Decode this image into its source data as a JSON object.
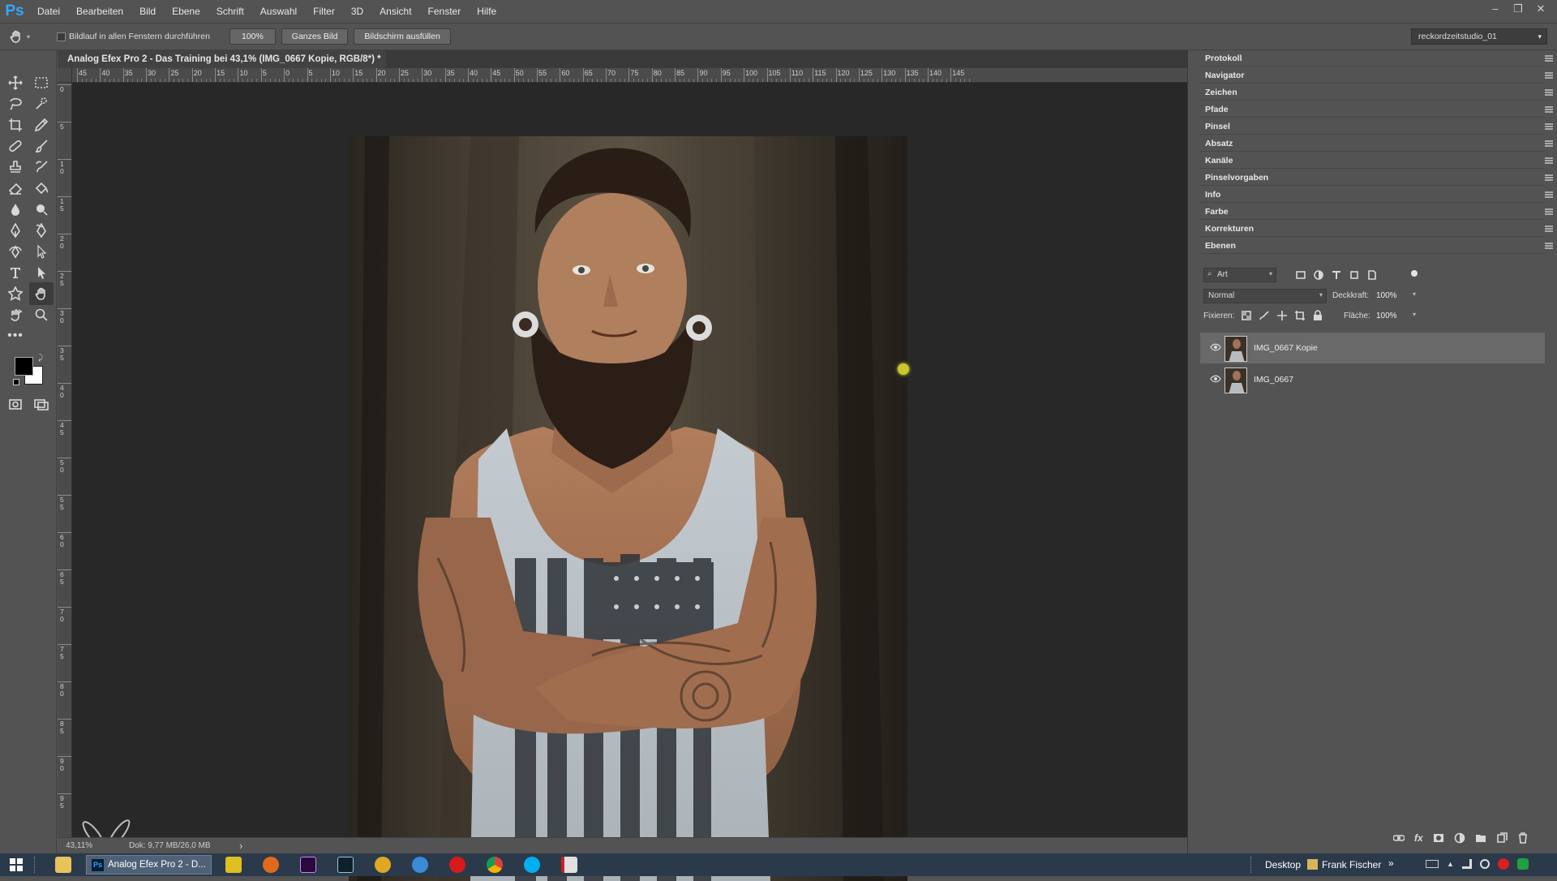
{
  "app": {
    "logo": "Ps"
  },
  "menu": [
    "Datei",
    "Bearbeiten",
    "Bild",
    "Ebene",
    "Schrift",
    "Auswahl",
    "Filter",
    "3D",
    "Ansicht",
    "Fenster",
    "Hilfe"
  ],
  "window_controls": [
    "–",
    "❐",
    "✕"
  ],
  "options_bar": {
    "scroll_all_label": "Bildlauf in allen Fenstern durchführen",
    "zoom_btn": "100%",
    "fit_btn": "Ganzes Bild",
    "fill_btn": "Bildschirm ausfüllen",
    "workspace": "reckordzeitstudio_01"
  },
  "document": {
    "tab_title": "Analog Efex Pro 2 - Das Training bei 43,1% (IMG_0667 Kopie, RGB/8*) *",
    "tab_close": "×"
  },
  "ruler_h_labels": [
    "45",
    "40",
    "35",
    "30",
    "25",
    "20",
    "15",
    "10",
    "5",
    "0",
    "5",
    "10",
    "15",
    "20",
    "25",
    "30",
    "35",
    "40",
    "45",
    "50",
    "55",
    "60",
    "65",
    "70",
    "75",
    "80",
    "85",
    "90",
    "95",
    "100",
    "105",
    "110",
    "115",
    "120",
    "125",
    "130",
    "135",
    "140",
    "145"
  ],
  "ruler_v_labels": [
    "0",
    "5",
    "1 0",
    "1 5",
    "2 0",
    "2 5",
    "3 0",
    "3 5",
    "4 0",
    "4 5",
    "5 0",
    "5 5",
    "6 0",
    "6 5",
    "7 0",
    "7 5",
    "8 0",
    "8 5",
    "9 0",
    "9 5"
  ],
  "status": {
    "zoom": "43,11%",
    "doc": "Dok: 9,77 MB/26,0 MB",
    "arrow": "›"
  },
  "panels": [
    "Protokoll",
    "Navigator",
    "Zeichen",
    "Pfade",
    "Pinsel",
    "Absatz",
    "Kanäle",
    "Pinselvorgaben",
    "Info",
    "Farbe",
    "Korrekturen",
    "Ebenen"
  ],
  "layers": {
    "filter_kind": "Art",
    "blend_mode": "Normal",
    "opacity_label": "Deckkraft:",
    "opacity_value": "100%",
    "lock_label": "Fixieren:",
    "fill_label": "Fläche:",
    "fill_value": "100%",
    "items": [
      {
        "name": "IMG_0667 Kopie",
        "selected": true
      },
      {
        "name": "IMG_0667",
        "selected": false
      }
    ],
    "footer_icons": [
      "link-icon",
      "fx-icon",
      "mask-icon",
      "adjustment-icon",
      "folder-icon",
      "new-layer-icon",
      "trash-icon"
    ],
    "fx_label": "fx"
  },
  "taskbar": {
    "active_app": "Analog Efex Pro 2 - D...",
    "desktop": "Desktop",
    "user": "Frank Fischer",
    "chevron": "»"
  },
  "colors": {
    "ps_blue": "#31a8ff",
    "panel": "#535353",
    "canvas": "#282828",
    "taskbar": "#2b3a4a"
  }
}
